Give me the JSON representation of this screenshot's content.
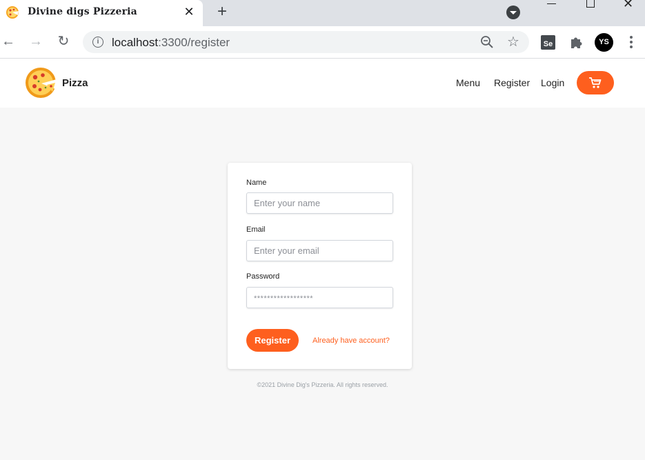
{
  "browser": {
    "tab": {
      "title": "Divine digs Pizzeria",
      "close_icon": "close-icon"
    },
    "new_tab_label": "+",
    "url_host": "localhost",
    "url_path": ":3300/register",
    "extension_se": "Se",
    "avatar_initials": "YS"
  },
  "header": {
    "logo_text": "Pizza",
    "nav": {
      "menu": "Menu",
      "register": "Register",
      "login": "Login"
    },
    "cart_icon": "cart-icon"
  },
  "form": {
    "name": {
      "label": "Name",
      "placeholder": "Enter your name"
    },
    "email": {
      "label": "Email",
      "placeholder": "Enter your email"
    },
    "password": {
      "label": "Password",
      "placeholder": "******************"
    },
    "submit_label": "Register",
    "login_link": "Already have account?"
  },
  "footer": {
    "text": "©2021 Divine Dig's Pizzeria. All rights reserved."
  },
  "colors": {
    "accent": "#fe5f1e",
    "page_bg": "#f7f7f7"
  }
}
